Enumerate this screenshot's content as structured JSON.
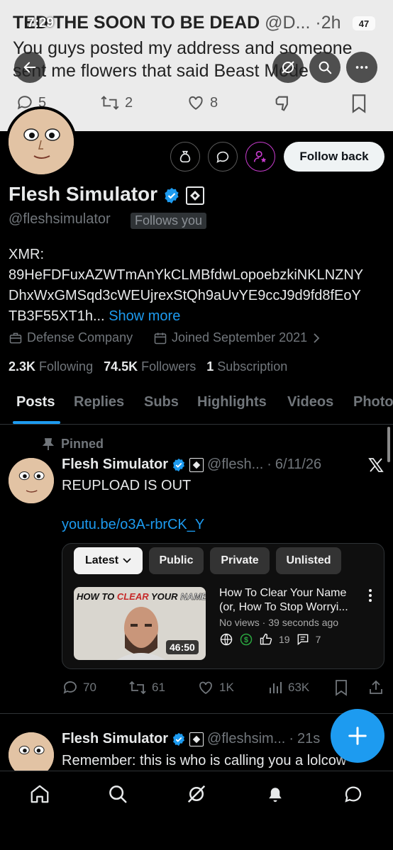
{
  "status_bar": {
    "time": "7:29",
    "battery": "47"
  },
  "banner_tweet": {
    "author": "TED THE SOON TO BE DEAD",
    "handle": "@D...",
    "time": "2h",
    "text_line1": "You guys posted my address and someone",
    "text_line2": "sent me flowers that said Beast Mode",
    "replies": "5",
    "reposts": "2",
    "likes": "8"
  },
  "profile": {
    "follow_label": "Follow back",
    "name": "Flesh Simulator",
    "handle": "@fleshsimulator",
    "follows_you": "Follows you",
    "bio_line1": "XMR:",
    "bio_line2": "89HeFDFuxAZWTmAnYkCLMBfdwLopoebzkiNKLNZNY",
    "bio_line3": "DhxWxGMSqd3cWEUjrexStQh9aUvYE9ccJ9d9fd8fEoY",
    "bio_line4": "TB3F55XT1h...",
    "show_more": "Show more",
    "category": "Defense Company",
    "joined": "Joined September 2021",
    "following_count": "2.3K",
    "following_label": "Following",
    "followers_count": "74.5K",
    "followers_label": "Followers",
    "subs_count": "1",
    "subs_label": "Subscription"
  },
  "tabs": [
    "Posts",
    "Replies",
    "Subs",
    "Highlights",
    "Videos",
    "Photo"
  ],
  "post1": {
    "pinned": "Pinned",
    "name": "Flesh Simulator",
    "handle": "@flesh...",
    "date": "6/11/26",
    "text": "REUPLOAD IS OUT",
    "link": "youtu.be/o3A-rbrCK_Y",
    "chips": [
      "Latest",
      "Public",
      "Private",
      "Unlisted"
    ],
    "video": {
      "thumb_text1": "HOW TO",
      "thumb_text2": "CLEAR",
      "thumb_text3": "YOUR",
      "thumb_text4": "NAME",
      "duration": "46:50",
      "title_line1": "How To Clear Your Name",
      "title_line2": "(or, How To Stop Worryi...",
      "meta": "No views · 39 seconds ago",
      "likes": "19",
      "comments": "7"
    },
    "replies": "70",
    "reposts": "61",
    "likes": "1K",
    "views": "63K"
  },
  "post2": {
    "name": "Flesh Simulator",
    "handle": "@fleshsim...",
    "time": "21s",
    "text": "Remember: this is who is calling you a lolcow"
  },
  "colors": {
    "accent": "#1d9bf0",
    "background": "#000000",
    "verified": "#1d9bf0",
    "subscribe": "#c93ccf"
  }
}
